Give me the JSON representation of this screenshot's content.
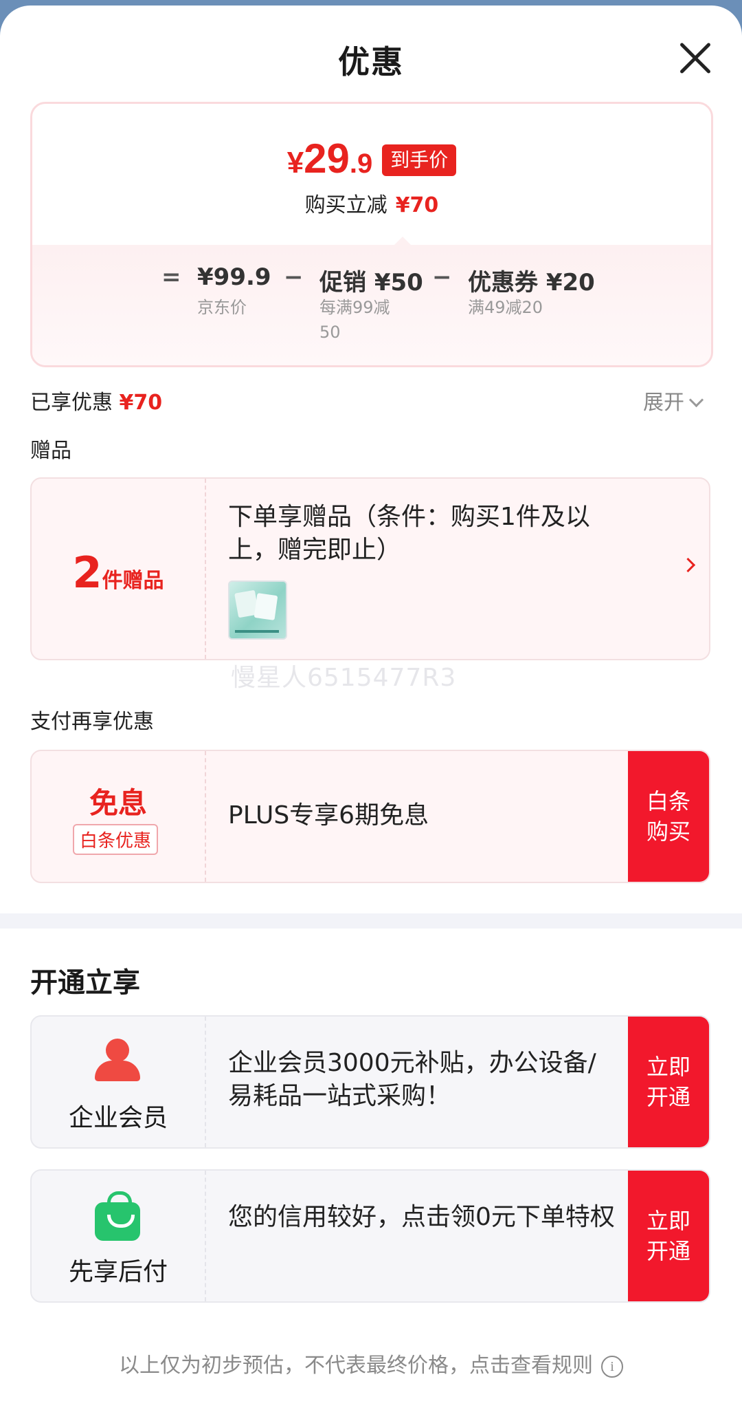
{
  "header": {
    "title": "优惠"
  },
  "price": {
    "currency": "¥",
    "integer": "29",
    "decimal": ".9",
    "tag": "到手价",
    "saved_label": "购买立减",
    "saved_value": "¥70"
  },
  "calc": {
    "equals": "=",
    "minus": "−",
    "jd_price": "¥99.9",
    "jd_label": "京东价",
    "promo": "促销 ¥50",
    "promo_line1": "每满99减",
    "promo_line2": "50",
    "coupon": "优惠券 ¥20",
    "coupon_label": "满49减20"
  },
  "enjoyed": {
    "label": "已享优惠",
    "value": "¥70",
    "expand": "展开"
  },
  "gift": {
    "section": "赠品",
    "count": "2",
    "unit": "件赠品",
    "text": "下单享赠品（条件：购买1件及以上，赠完即止）"
  },
  "watermark": "慢星人6515477R3",
  "pay": {
    "section": "支付再享优惠",
    "title": "免息",
    "badge": "白条优惠",
    "text": "PLUS专享6期免息",
    "btn_line1": "白条",
    "btn_line2": "购买"
  },
  "activate": {
    "section": "开通立享",
    "items": [
      {
        "name": "企业会员",
        "text": " 企业会员3000元补贴，办公设备/易耗品一站式采购！",
        "btn_line1": "立即",
        "btn_line2": "开通"
      },
      {
        "name": "先享后付",
        "text": "您的信用较好，点击领0元下单特权",
        "btn_line1": "立即",
        "btn_line2": "开通"
      }
    ]
  },
  "footer": {
    "text": "以上仅为初步预估，不代表最终价格，点击查看规则",
    "info": "i"
  },
  "colors": {
    "accent": "#e8231f",
    "button": "#f2182c",
    "member_icon": "#ef4a42",
    "pay_icon": "#27c46d"
  }
}
